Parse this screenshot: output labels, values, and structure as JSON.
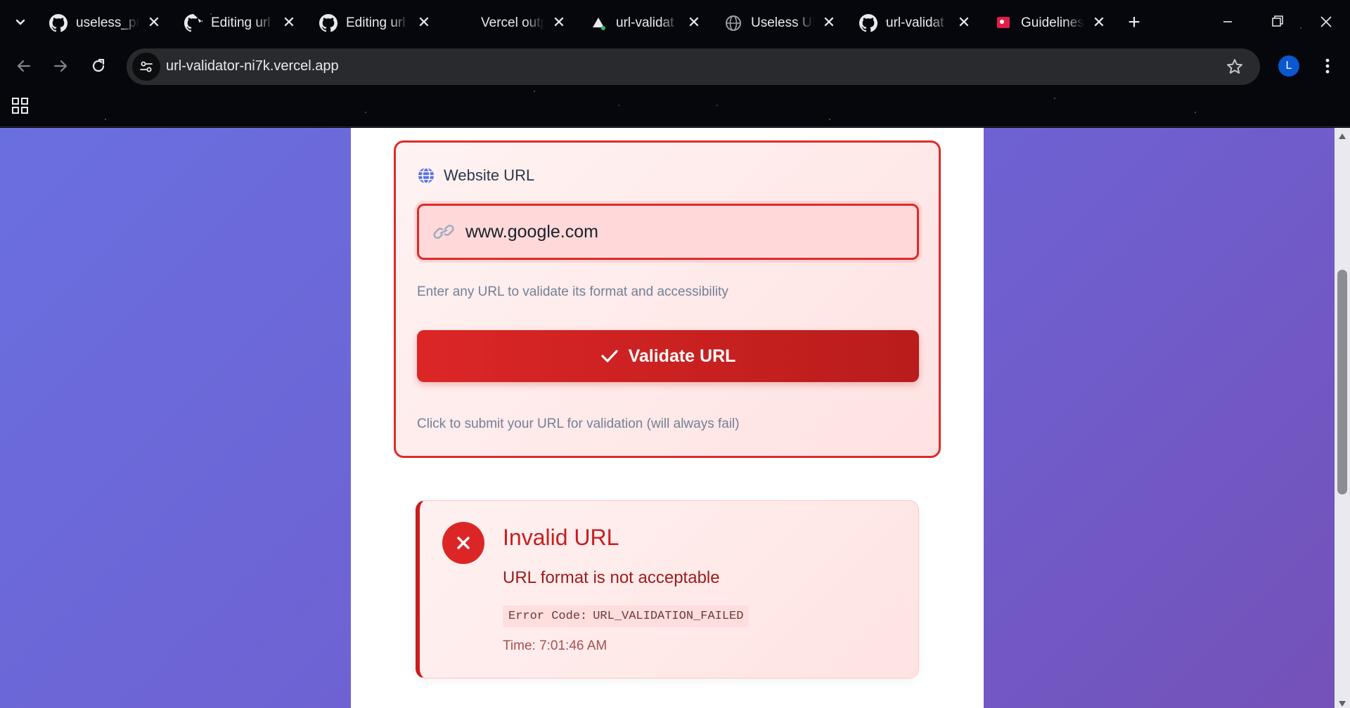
{
  "browser": {
    "tabs": [
      {
        "title": "useless_pro",
        "icon": "github-icon"
      },
      {
        "title": "Editing url",
        "icon": "github-icon"
      },
      {
        "title": "Editing url",
        "icon": "github-icon"
      },
      {
        "title": "Vercel outp",
        "icon": "none"
      },
      {
        "title": "url-validat",
        "icon": "vercel-icon"
      },
      {
        "title": "Useless UR",
        "icon": "globe-icon"
      },
      {
        "title": "url-validat",
        "icon": "github-icon"
      },
      {
        "title": "Guidelines",
        "icon": "guidelines-icon"
      }
    ],
    "address": "url-validator-ni7k.vercel.app",
    "profile_initial": "L"
  },
  "form": {
    "label": "Website URL",
    "input_value": "www.google.com",
    "help_text": "Enter any URL to validate its format and accessibility",
    "button_label": "Validate URL",
    "submit_note": "Click to submit your URL for validation (will always fail)"
  },
  "result": {
    "title": "Invalid URL",
    "message": "URL format is not acceptable",
    "error_code_label": "Error Code:",
    "error_code": "URL_VALIDATION_FAILED",
    "time": "Time: 7:01:46 AM"
  },
  "colors": {
    "error_red": "#dc2626",
    "error_dark": "#c81e1e",
    "bg_gradient_start": "#6a6fe0",
    "bg_gradient_end": "#7451b8"
  }
}
